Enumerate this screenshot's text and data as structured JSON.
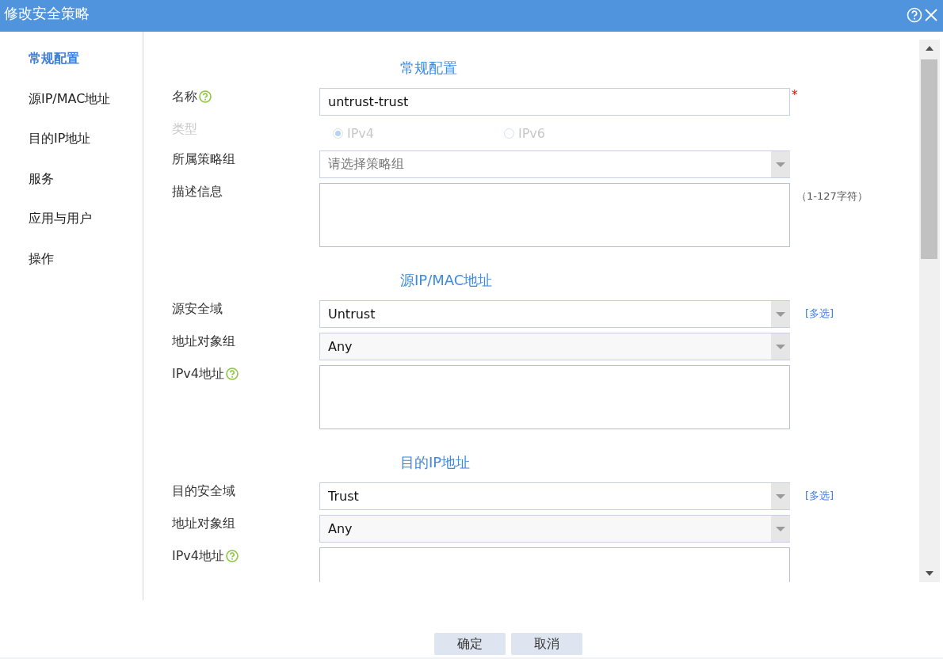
{
  "window": {
    "title": "修改安全策略"
  },
  "sidebar": {
    "items": [
      {
        "label": "常规配置",
        "selected": true
      },
      {
        "label": "源IP/MAC地址",
        "selected": false
      },
      {
        "label": "目的IP地址",
        "selected": false
      },
      {
        "label": "服务",
        "selected": false
      },
      {
        "label": "应用与用户",
        "selected": false
      },
      {
        "label": "操作",
        "selected": false
      }
    ]
  },
  "sections": [
    {
      "title": "常规配置",
      "fields": [
        {
          "kind": "text",
          "label": "名称",
          "help": true,
          "value": "untrust-trust",
          "required": "*"
        },
        {
          "kind": "radio",
          "label": "类型",
          "disabled": true,
          "options": [
            {
              "label": "IPv4",
              "selected": true
            },
            {
              "label": "IPv6",
              "selected": false
            }
          ]
        },
        {
          "kind": "select",
          "label": "所属策略组",
          "placeholder": "请选择策略组"
        },
        {
          "kind": "textarea",
          "label": "描述信息",
          "note": "（1-127字符）"
        }
      ]
    },
    {
      "title": "源IP/MAC地址",
      "fields": [
        {
          "kind": "select",
          "label": "源安全域",
          "value": "Untrust",
          "link": "[多选]"
        },
        {
          "kind": "select",
          "label": "地址对象组",
          "value": "Any",
          "shaded": true
        },
        {
          "kind": "textarea",
          "label": "IPv4地址",
          "help": true
        }
      ]
    },
    {
      "title": "目的IP地址",
      "fields": [
        {
          "kind": "select",
          "label": "目的安全域",
          "value": "Trust",
          "link": "[多选]"
        },
        {
          "kind": "select",
          "label": "地址对象组",
          "value": "Any",
          "shaded": true
        },
        {
          "kind": "textarea",
          "label": "IPv4地址",
          "help": true
        }
      ]
    }
  ],
  "buttons": [
    "确定",
    "取消"
  ]
}
